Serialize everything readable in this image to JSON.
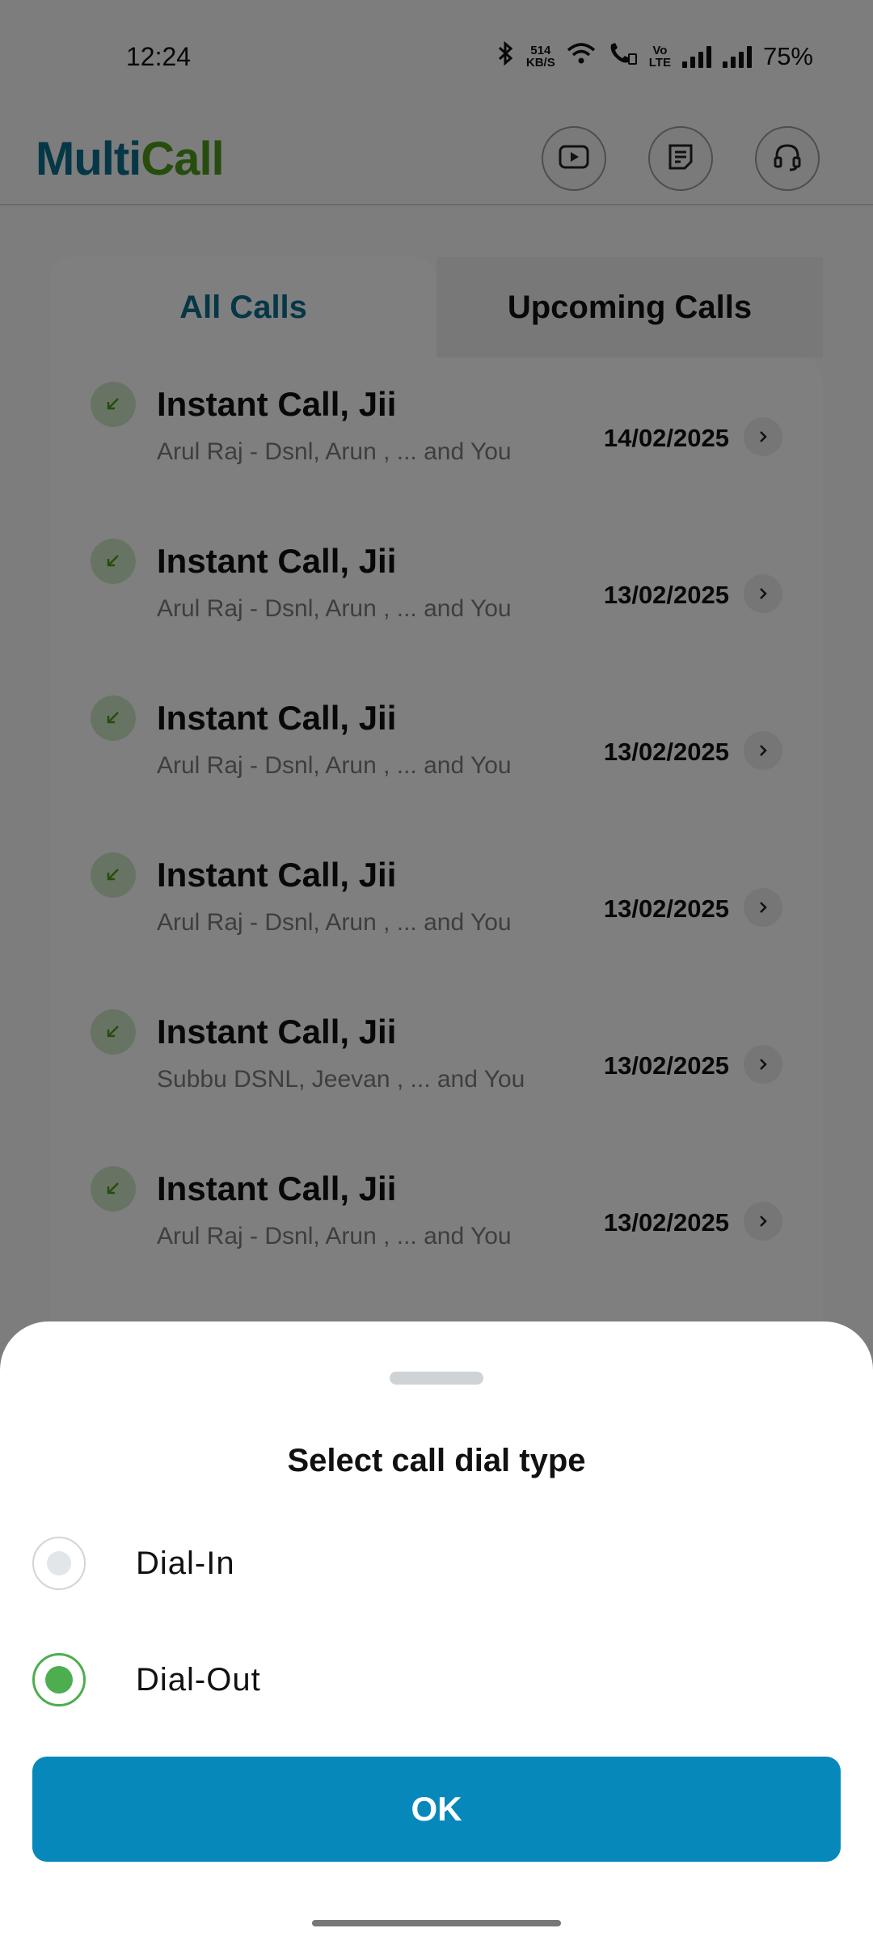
{
  "status_bar": {
    "time": "12:24",
    "net_speed_value": "514",
    "net_speed_unit": "KB/S",
    "volte_top": "Vo",
    "volte_bottom": "LTE",
    "battery": "75%"
  },
  "header": {
    "logo_part1": "Multi",
    "logo_part2": "Call",
    "icons": [
      "youtube-icon",
      "notes-icon",
      "headset-icon"
    ]
  },
  "tabs": [
    {
      "label": "All Calls",
      "active": true
    },
    {
      "label": "Upcoming Calls",
      "active": false
    }
  ],
  "calls": [
    {
      "title": "Instant Call, Jii",
      "participants": "Arul Raj - Dsnl, Arun , ... and You",
      "date": "14/02/2025"
    },
    {
      "title": "Instant Call, Jii",
      "participants": "Arul Raj - Dsnl, Arun , ... and You",
      "date": "13/02/2025"
    },
    {
      "title": "Instant Call, Jii",
      "participants": "Arul Raj - Dsnl, Arun , ... and You",
      "date": "13/02/2025"
    },
    {
      "title": "Instant Call, Jii",
      "participants": "Arul Raj - Dsnl, Arun , ... and You",
      "date": "13/02/2025"
    },
    {
      "title": "Instant Call, Jii",
      "participants": "Subbu DSNL, Jeevan , ... and You",
      "date": "13/02/2025"
    },
    {
      "title": "Instant Call, Jii",
      "participants": "Arul Raj - Dsnl, Arun , ... and You",
      "date": "13/02/2025"
    }
  ],
  "sheet": {
    "title": "Select call dial type",
    "options": [
      {
        "label": "Dial-In",
        "selected": false
      },
      {
        "label": "Dial-Out",
        "selected": true
      }
    ],
    "ok_label": "OK"
  },
  "colors": {
    "accent": "#0788bb",
    "logo_blue": "#0a6f8f",
    "logo_green": "#4c9a1a",
    "radio_selected": "#4cae4f"
  }
}
